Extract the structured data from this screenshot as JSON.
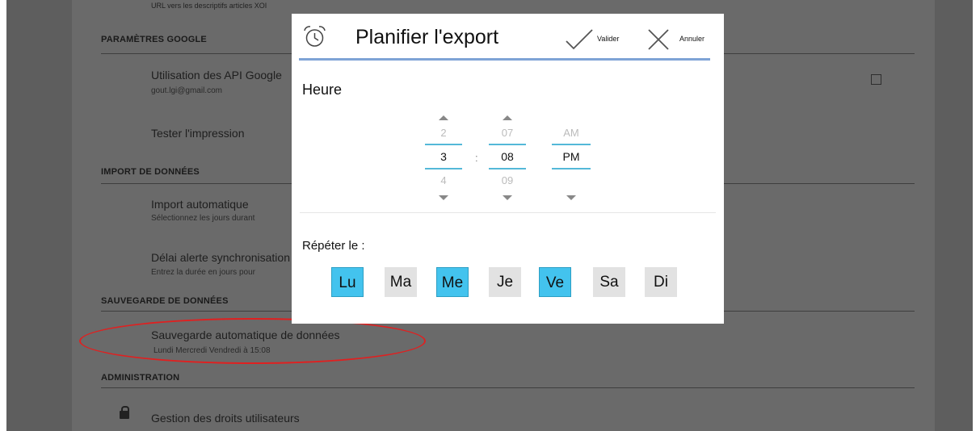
{
  "settings": {
    "top_cut_text": "URL vers les descriptifs articles XOI",
    "sections": {
      "google": "PARAMÈTRES GOOGLE",
      "import": "IMPORT DE DONNÉES",
      "backup": "SAUVEGARDE DE DONNÉES",
      "admin": "ADMINISTRATION"
    },
    "items": {
      "google_api_title": "Utilisation des API Google",
      "google_api_sub": "gout.lgi@gmail.com",
      "print_test": "Tester l'impression",
      "auto_import_title": "Import automatique",
      "auto_import_sub": "Sélectionnez les jours durant",
      "sync_delay_title": "Délai alerte synchronisation",
      "sync_delay_sub": "Entrez la durée en jours pour",
      "auto_backup_title": "Sauvegarde automatique de données",
      "auto_backup_sub": "Lundi Mercredi Vendredi à 15:08",
      "user_rights": "Gestion des droits utilisateurs"
    }
  },
  "dialog": {
    "title": "Planifier l'export",
    "confirm_label": "Valider",
    "cancel_label": "Annuler",
    "time_label": "Heure",
    "hour": {
      "prev": "2",
      "current": "3",
      "next": "4"
    },
    "separator": ":",
    "minute": {
      "prev": "07",
      "current": "08",
      "next": "09"
    },
    "ampm": {
      "prev": "AM",
      "current": "PM"
    },
    "repeat_label": "Répéter le :",
    "days": [
      {
        "label": "Lu",
        "selected": true
      },
      {
        "label": "Ma",
        "selected": false
      },
      {
        "label": "Me",
        "selected": true
      },
      {
        "label": "Je",
        "selected": false
      },
      {
        "label": "Ve",
        "selected": true
      },
      {
        "label": "Sa",
        "selected": false
      },
      {
        "label": "Di",
        "selected": false
      }
    ]
  },
  "colors": {
    "accent": "#43c3ee",
    "title_underline": "#7ea3d6",
    "highlight_oval": "#e02020"
  },
  "icons": [
    "alarm-clock-icon",
    "checkmark-icon",
    "close-icon",
    "lock-icon",
    "chevron-up-icon",
    "chevron-down-icon"
  ]
}
